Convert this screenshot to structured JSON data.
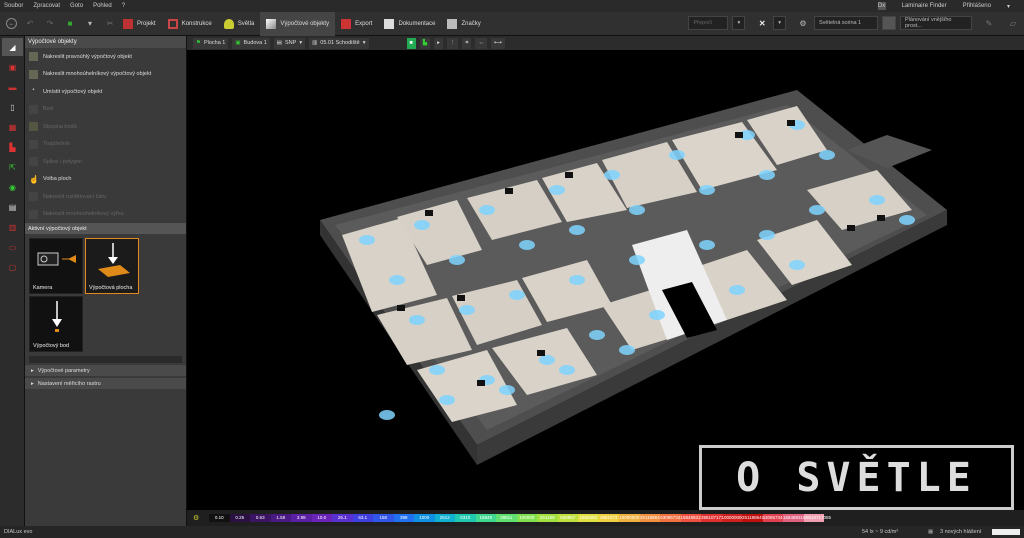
{
  "menu": [
    "Soubor",
    "Zpracovat",
    "Goto",
    "Pohled",
    "?"
  ],
  "menu_right": {
    "dx": "Dx",
    "finder": "Laminaire Finder",
    "login": "Přihlášeno"
  },
  "tabs": [
    {
      "label": "Projekt",
      "icon": "project-icon"
    },
    {
      "label": "Konstrukce",
      "icon": "construction-icon"
    },
    {
      "label": "Světla",
      "icon": "light-icon"
    },
    {
      "label": "Výpočtové objekty",
      "icon": "calc-objects-icon",
      "active": true
    },
    {
      "label": "Export",
      "icon": "export-icon"
    },
    {
      "label": "Dokumentace",
      "icon": "doc-icon"
    },
    {
      "label": "Značky",
      "icon": "tag-icon"
    }
  ],
  "toolbar_right": {
    "preset": "Přepočí",
    "scene": "Světelná scéna 1",
    "plan": "Plánování vnějšího prost..."
  },
  "panel": {
    "title": "Výpočtové objekty",
    "items": [
      {
        "label": "Nakreslit pravoúhlý výpočtový objekt",
        "dim": false
      },
      {
        "label": "Nakreslit mnohoúhelníkový výpočtový objekt",
        "dim": false
      },
      {
        "label": "Umístit výpočtový objekt",
        "dim": false
      },
      {
        "label": "Bod",
        "dim": true
      },
      {
        "label": "Skupina bodů",
        "dim": true
      },
      {
        "label": "Trojúhelník",
        "dim": true
      },
      {
        "label": "Spline / polygon",
        "dim": true
      },
      {
        "label": "Volba ploch",
        "dim": false
      },
      {
        "label": "Nakreslit rozdělovací čáru",
        "dim": true
      },
      {
        "label": "Nakreslit mnohoúhelníkový výřez",
        "dim": true
      }
    ],
    "active_section": "Aktivní výpočtový objekt",
    "tiles": [
      {
        "label": "Kamera",
        "selected": false
      },
      {
        "label": "Výpočtová plocha",
        "selected": true
      },
      {
        "label": "Výpočtový bod",
        "selected": false
      }
    ],
    "sections": [
      "Výpočtové parametry",
      "Nastavení měřicího rastru"
    ]
  },
  "viewbar": {
    "crumbs": [
      "Plocha 1",
      "Budova 1",
      "SNP",
      "05.01 Schodiště"
    ]
  },
  "legend": {
    "values": [
      "0.10",
      "0.25",
      "0.63",
      "1.58",
      "3.98",
      "10.0",
      "25.1",
      "63.1",
      "158",
      "398",
      "1000",
      "2512",
      "6310",
      "15849",
      "39811",
      "100000",
      "251189",
      "630957",
      "1584893",
      "3981072",
      "10000000",
      "25118864",
      "63095734",
      "158489319",
      "398107171",
      "1000000000",
      "2511886432",
      "6309573445",
      "15848931925",
      "39810717055"
    ],
    "colors": [
      "#111",
      "#2a1142",
      "#3b1563",
      "#4a1a83",
      "#5b1fa3",
      "#6a24b8",
      "#5b30d0",
      "#4040e0",
      "#3055e8",
      "#2070f0",
      "#1090e0",
      "#10b0d0",
      "#20c8b0",
      "#40d890",
      "#60e070",
      "#80e050",
      "#a0e040",
      "#c0e040",
      "#e0e040",
      "#f0d040",
      "#f0b040",
      "#f09040",
      "#f07040",
      "#f05040",
      "#e03030",
      "#d02020",
      "#c01010",
      "#e04050",
      "#e06080",
      "#f0a0b0"
    ]
  },
  "status": {
    "brand": "DIALux evo",
    "luminance": "54 lx ~ 9 cd/m²",
    "notices": "3 nových hlášení"
  },
  "watermark": "O SVĚTLE"
}
